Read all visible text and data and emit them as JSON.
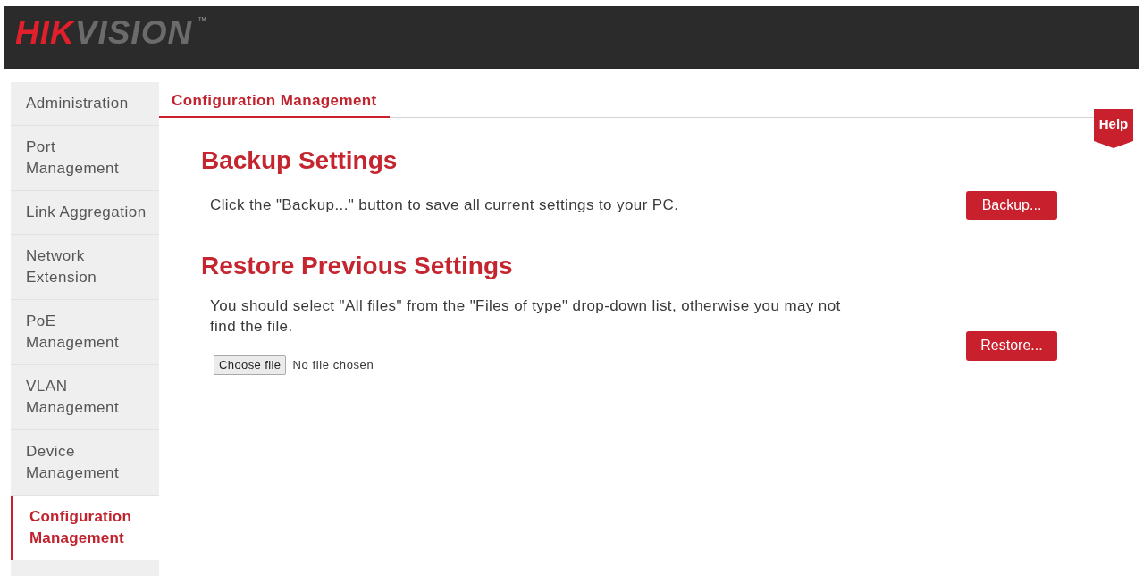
{
  "header": {
    "logo": {
      "parts": [
        {
          "text": "HIK",
          "color": "#e2202b"
        },
        {
          "text": "VISION",
          "color": "#6b6b6b"
        }
      ],
      "trademark": "™"
    }
  },
  "sidebar": {
    "items": [
      {
        "label": "Administration",
        "selected": false
      },
      {
        "label": "Port\nManagement",
        "selected": false
      },
      {
        "label": "Link Aggregation",
        "selected": false
      },
      {
        "label": "Network\nExtension",
        "selected": false
      },
      {
        "label": "PoE\nManagement",
        "selected": false
      },
      {
        "label": "VLAN\nManagement",
        "selected": false
      },
      {
        "label": "Device\nManagement",
        "selected": false
      },
      {
        "label": "Configuration\nManagement",
        "selected": true
      }
    ]
  },
  "tab": {
    "label": "Configuration Management",
    "selected": true
  },
  "help": {
    "label": "Help"
  },
  "sections": [
    {
      "title": "Backup Settings",
      "description": "Click the \"Backup...\" button to save all current settings to your PC.",
      "button": "Backup..."
    },
    {
      "title": "Restore Previous Settings",
      "description": "You should select \"All files\" from the \"Files of type\" drop-down list, otherwise you may not find the file.",
      "file_input": {
        "button": "Choose file",
        "status": "No file chosen"
      },
      "button": "Restore..."
    }
  ]
}
